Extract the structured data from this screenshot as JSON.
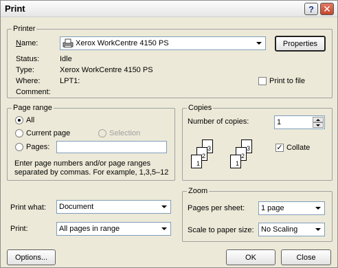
{
  "window": {
    "title": "Print",
    "help_glyph": "?",
    "close_glyph": "✕"
  },
  "printer": {
    "group_label": "Printer",
    "name_label": "Name:",
    "name_value": "Xerox WorkCentre 4150 PS",
    "properties_label": "Properties",
    "status_label": "Status:",
    "status_value": "Idle",
    "type_label": "Type:",
    "type_value": "Xerox WorkCentre 4150 PS",
    "where_label": "Where:",
    "where_value": "LPT1:",
    "comment_label": "Comment:",
    "print_to_file_label": "Print to file",
    "print_to_file_checked": false
  },
  "page_range": {
    "group_label": "Page range",
    "all_label": "All",
    "current_page_label": "Current page",
    "selection_label": "Selection",
    "pages_label": "Pages:",
    "pages_value": "",
    "selected": "all",
    "help_line1": "Enter page numbers and/or page ranges",
    "help_line2": "separated by commas.  For example, 1,3,5–12"
  },
  "copies": {
    "group_label": "Copies",
    "number_label": "Number of copies:",
    "number_value": "1",
    "collate_label": "Collate",
    "collate_checked": true,
    "collate_check_glyph": "✓",
    "page_digits": [
      "1",
      "2",
      "3"
    ]
  },
  "print_what": {
    "label": "Print what:",
    "value": "Document"
  },
  "print": {
    "label": "Print:",
    "value": "All pages in range"
  },
  "zoom": {
    "group_label": "Zoom",
    "pages_per_sheet_label": "Pages per sheet:",
    "pages_per_sheet_value": "1 page",
    "scale_label": "Scale to paper size:",
    "scale_value": "No Scaling"
  },
  "buttons": {
    "options": "Options...",
    "ok": "OK",
    "close": "Close"
  }
}
